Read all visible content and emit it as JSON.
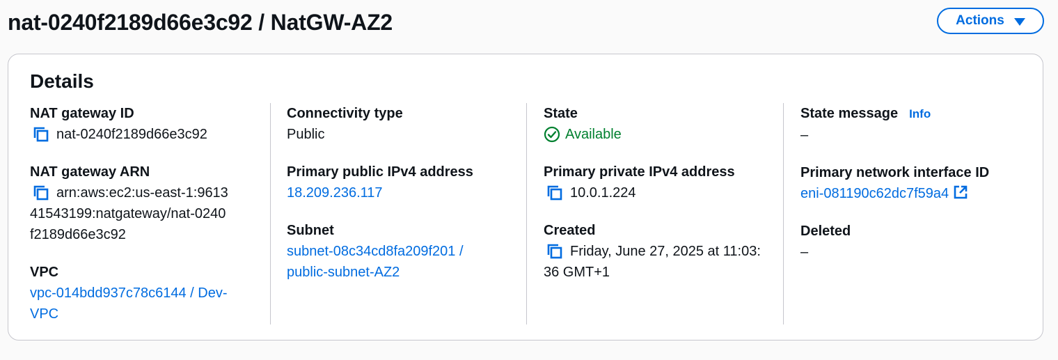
{
  "header": {
    "title": "nat-0240f2189d66e3c92 / NatGW-AZ2",
    "actions_label": "Actions"
  },
  "details": {
    "title": "Details",
    "nat_gateway_id": {
      "label": "NAT gateway ID",
      "value": "nat-0240f2189d66e3c92"
    },
    "nat_gateway_arn": {
      "label": "NAT gateway ARN",
      "value": "arn:aws:ec2:us-east-1:961341543199:natgateway/nat-0240f2189d66e3c92"
    },
    "vpc": {
      "label": "VPC",
      "value": "vpc-014bdd937c78c6144 / Dev-VPC"
    },
    "connectivity_type": {
      "label": "Connectivity type",
      "value": "Public"
    },
    "primary_public_ipv4": {
      "label": "Primary public IPv4 address",
      "value": "18.209.236.117"
    },
    "subnet": {
      "label": "Subnet",
      "value": "subnet-08c34cd8fa209f201 / public-subnet-AZ2"
    },
    "state": {
      "label": "State",
      "value": "Available"
    },
    "primary_private_ipv4": {
      "label": "Primary private IPv4 address",
      "value": "10.0.1.224"
    },
    "created": {
      "label": "Created",
      "value": "Friday, June 27, 2025 at 11:03:36 GMT+1"
    },
    "state_message": {
      "label": "State message",
      "info_label": "Info",
      "value": "–"
    },
    "primary_network_interface": {
      "label": "Primary network interface ID",
      "value": "eni-081190c62dc7f59a4"
    },
    "deleted": {
      "label": "Deleted",
      "value": "–"
    }
  },
  "colors": {
    "accent": "#006ce0",
    "success": "#00802f",
    "border": "#c6c6cd",
    "text": "#0f141a"
  },
  "icons": {
    "copy": "copy-icon",
    "status": "check-circle-icon",
    "external": "external-link-icon",
    "caret": "caret-down-icon"
  }
}
